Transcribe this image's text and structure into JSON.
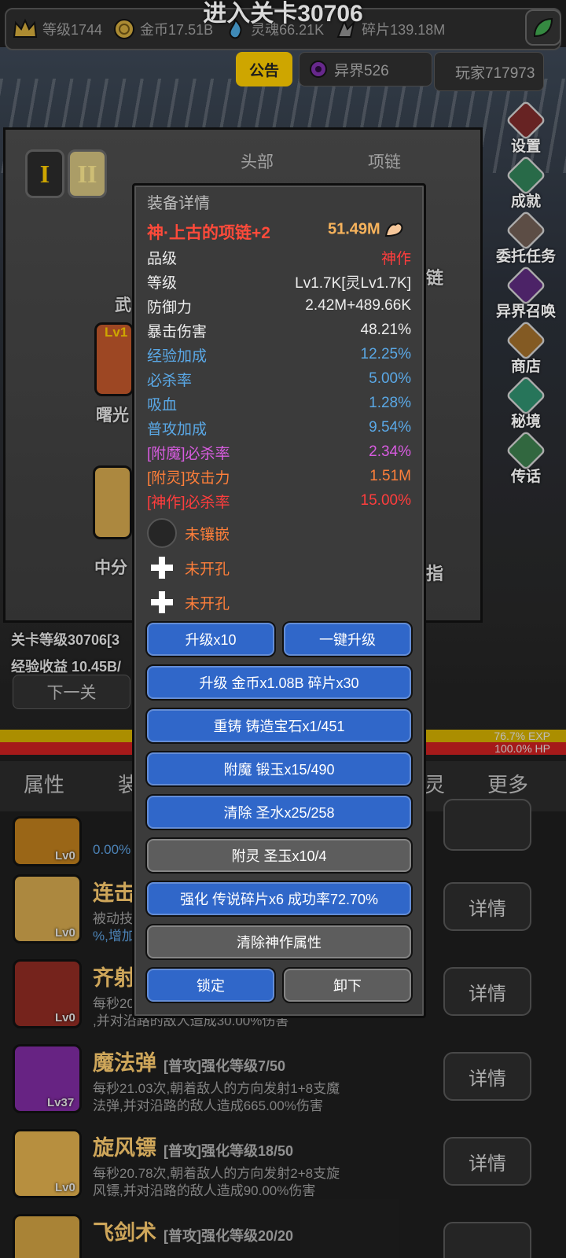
{
  "banner": "进入关卡30706",
  "resources": [
    {
      "icon": "crown-icon",
      "label": "等级1744"
    },
    {
      "icon": "coin-icon",
      "label": "金币17.51B"
    },
    {
      "icon": "soul-icon",
      "label": "灵魂66.21K"
    },
    {
      "icon": "shard-icon",
      "label": "碎片139.18M"
    }
  ],
  "top": {
    "notice": "公告",
    "otherworld": "异界526",
    "player": "玩家717973"
  },
  "right_menu": [
    "设置",
    "成就",
    "委托任务",
    "异界召唤",
    "商店",
    "秘境",
    "传话"
  ],
  "equip_panel": {
    "roman1": "I",
    "roman2": "II",
    "slot_head": "头部",
    "slot_necklace": "项链",
    "weapon_tab": "武",
    "item1": "曙光",
    "item1_lv": "Lv1",
    "item2": "中分",
    "right_label1": "链",
    "right_label2": "指"
  },
  "stage": {
    "level": "关卡等级30706[3",
    "exp": "经验收益 10.45B/",
    "next": "下一关"
  },
  "bars": {
    "exp": "76.7% EXP",
    "hp": "100.0% HP"
  },
  "tabs": [
    "属性",
    "装",
    "灵",
    "更多"
  ],
  "skills": [
    {
      "name": "连击",
      "lv": "Lv0",
      "sub": "",
      "desc_a": "被动技",
      "desc_b": "%,增加",
      "btn": "详情"
    },
    {
      "name": "齐射",
      "lv": "Lv0",
      "sub": "",
      "desc_a": "每秒20",
      "desc_b": ",并对沿路的敌人造成30.00%伤害",
      "btn": "详情"
    },
    {
      "name": "魔法弹",
      "lv": "Lv37",
      "sub": "[普攻]强化等级7/50",
      "desc_a": "每秒21.03次,朝着敌人的方向发射1+8支魔",
      "desc_b": "法弹,并对沿路的敌人造成665.00%伤害",
      "btn": "详情"
    },
    {
      "name": "旋风镖",
      "lv": "Lv0",
      "sub": "[普攻]强化等级18/50",
      "desc_a": "每秒20.78次,朝着敌人的方向发射2+8支旋",
      "desc_b": "风镖,并对沿路的敌人造成90.00%伤害",
      "btn": "详情"
    },
    {
      "name": "飞剑术",
      "lv": "",
      "sub": "[普攻]强化等级20/20",
      "desc_a": "",
      "desc_b": "",
      "btn": ""
    }
  ],
  "skill0_extra": "0.00%",
  "modal": {
    "title": "装备详情",
    "item_name": "神·上古的项链+2",
    "power": "51.49M",
    "stats": [
      {
        "k": "品级",
        "v": "神作",
        "cls": "c-redv"
      },
      {
        "k": "等级",
        "v": "Lv1.7K[灵Lv1.7K]",
        "cls": ""
      },
      {
        "k": "防御力",
        "v": "2.42M+489.66K",
        "cls": ""
      },
      {
        "k": "暴击伤害",
        "v": "48.21%",
        "cls": ""
      },
      {
        "k": "经验加成",
        "v": "12.25%",
        "cls": "c-blue"
      },
      {
        "k": "必杀率",
        "v": "5.00%",
        "cls": "c-blue"
      },
      {
        "k": "吸血",
        "v": "1.28%",
        "cls": "c-blue"
      },
      {
        "k": "普攻加成",
        "v": "9.54%",
        "cls": "c-blue"
      },
      {
        "k": "[附魔]必杀率",
        "v": "2.34%",
        "cls": "c-purple"
      },
      {
        "k": "[附灵]攻击力",
        "v": "1.51M",
        "cls": "c-orange"
      },
      {
        "k": "[神作]必杀率",
        "v": "15.00%",
        "cls": "c-red"
      }
    ],
    "sockets": [
      "未镶嵌",
      "未开孔",
      "未开孔"
    ],
    "buttons": {
      "upgrade10": "升级x10",
      "one_key": "一键升级",
      "upgrade": "升级 金币x1.08B 碎片x30",
      "recast": "重铸 铸造宝石x1/451",
      "enchant": "附魔 锻玉x15/490",
      "clear": "清除 圣水x25/258",
      "spirit": "附灵 圣玉x10/4",
      "strengthen": "强化 传说碎片x6 成功率72.70%",
      "clear_divine": "清除神作属性",
      "lock": "锁定",
      "unequip": "卸下"
    }
  },
  "colors": {
    "blue_button": "#3067c9",
    "gold": "#f2c300",
    "red_item": "#ff4a3a"
  }
}
